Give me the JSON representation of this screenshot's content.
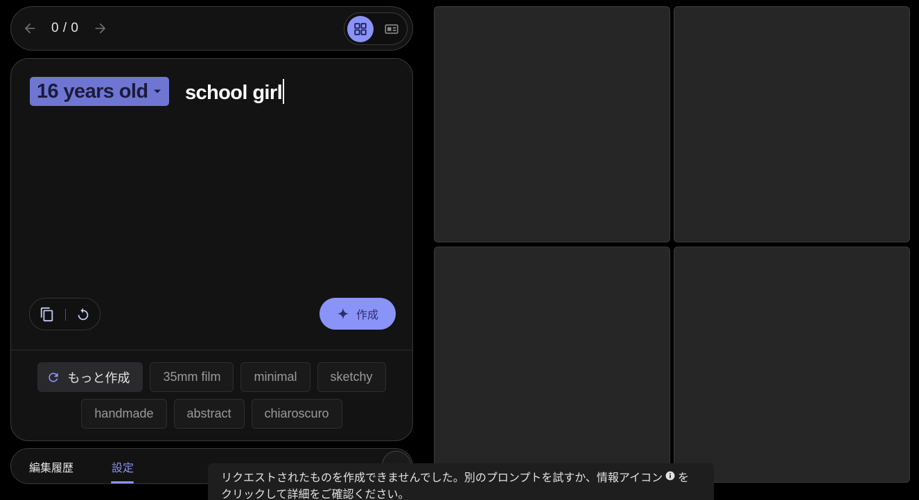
{
  "nav": {
    "counter": "0 / 0",
    "prev_icon": "arrow-left-icon",
    "next_icon": "arrow-right-icon",
    "view_grid_icon": "grid-view-icon",
    "view_single_icon": "single-view-icon",
    "active_view": "grid"
  },
  "prompt": {
    "selected_option": "16 years old",
    "text": "school girl",
    "generate_label": "作成",
    "tools": [
      "copy-icon",
      "reset-icon"
    ]
  },
  "suggestions": {
    "more_label": "もっと作成",
    "chips": [
      "35mm film",
      "minimal",
      "sketchy",
      "handmade",
      "abstract",
      "chiaroscuro"
    ]
  },
  "bottom_tabs": {
    "history": "編集履歴",
    "settings": "設定",
    "active": "settings"
  },
  "toast": {
    "message_part1": "リクエストされたものを作成できませんでした。別のプロンプトを試すか、情報アイコン",
    "message_part2": "を",
    "message_part3": "クリックして詳細をご確認ください。"
  },
  "colors": {
    "accent": "#8a93f8",
    "chip_bg": "#6f75d3",
    "panel_bg": "#131313",
    "tile_bg": "#262626",
    "page_bg": "#000000"
  }
}
